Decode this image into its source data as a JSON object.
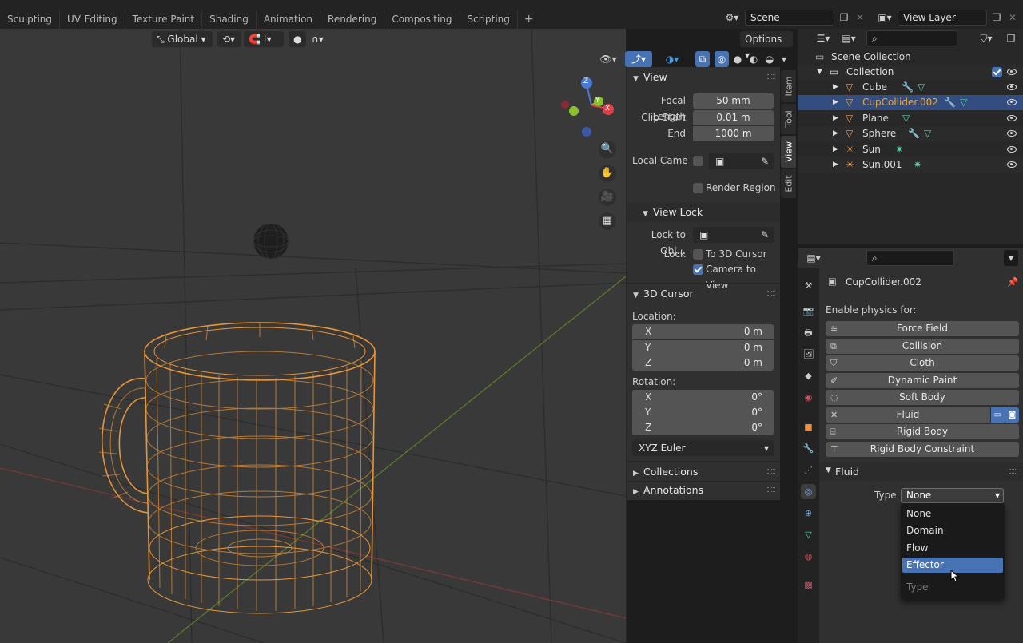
{
  "workspace_tabs": [
    "Sculpting",
    "UV Editing",
    "Texture Paint",
    "Shading",
    "Animation",
    "Rendering",
    "Compositing",
    "Scripting"
  ],
  "scene": {
    "label": "Scene"
  },
  "view_layer": {
    "label": "View Layer"
  },
  "viewport_header": {
    "orientation": "Global",
    "options_label": "Options"
  },
  "gizmo_axes": {
    "z": "Z",
    "y": "Y",
    "x": "X"
  },
  "npanel": {
    "view": {
      "title": "View",
      "focal_length_label": "Focal Length",
      "focal_length": "50 mm",
      "clip_start_label": "Clip Start",
      "clip_start": "0.01 m",
      "end_label": "End",
      "end": "1000 m",
      "local_camera_label": "Local Came",
      "render_region_label": "Render Region"
    },
    "view_lock": {
      "title": "View Lock",
      "lock_to_object_label": "Lock to Obj...",
      "lock_label": "Lock",
      "to_3d_cursor_label": "To 3D Cursor",
      "camera_to_view_label": "Camera to View"
    },
    "cursor": {
      "title": "3D Cursor",
      "location_label": "Location:",
      "location": [
        {
          "axis": "X",
          "value": "0 m"
        },
        {
          "axis": "Y",
          "value": "0 m"
        },
        {
          "axis": "Z",
          "value": "0 m"
        }
      ],
      "rotation_label": "Rotation:",
      "rotation": [
        {
          "axis": "X",
          "value": "0°"
        },
        {
          "axis": "Y",
          "value": "0°"
        },
        {
          "axis": "Z",
          "value": "0°"
        }
      ],
      "rotation_mode": "XYZ Euler"
    },
    "collections_title": "Collections",
    "annotations_title": "Annotations"
  },
  "side_tabs": [
    "Item",
    "Tool",
    "View",
    "Edit"
  ],
  "outliner": {
    "scene_collection": "Scene Collection",
    "collection": "Collection",
    "objects": [
      {
        "name": "Cube",
        "selected": false
      },
      {
        "name": "CupCollider.002",
        "selected": true
      },
      {
        "name": "Plane",
        "selected": false
      },
      {
        "name": "Sphere",
        "selected": false
      },
      {
        "name": "Sun",
        "selected": false
      },
      {
        "name": "Sun.001",
        "selected": false
      }
    ]
  },
  "properties": {
    "object_name": "CupCollider.002",
    "enable_physics_label": "Enable physics for:",
    "physics_buttons": [
      "Force Field",
      "Collision",
      "Cloth",
      "Dynamic Paint",
      "Soft Body",
      "Fluid",
      "Rigid Body",
      "Rigid Body Constraint"
    ],
    "fluid_panel_title": "Fluid",
    "type_label": "Type",
    "type_value": "None",
    "dropdown_options": [
      "None",
      "Domain",
      "Flow",
      "Effector"
    ],
    "dropdown_highlighted": "Effector",
    "dropdown_footer": "Type"
  },
  "colors": {
    "accent": "#4772b3",
    "selection": "#334d80",
    "wire": "#f29a36"
  }
}
